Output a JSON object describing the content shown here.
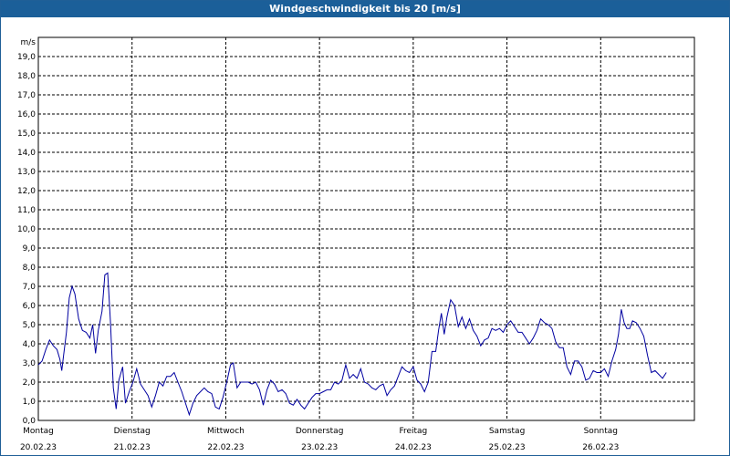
{
  "title": "Windgeschwindigkeit bis 20 [m/s]",
  "colors": {
    "title_bg": "#1b5f99",
    "title_text": "#ffffff",
    "series": "#0000a0",
    "grid": "#000000"
  },
  "chart_data": {
    "type": "line",
    "title": "Windgeschwindigkeit bis 20 [m/s]",
    "ylabel": "m/s",
    "ylim": [
      0,
      20
    ],
    "yticks": [
      "0,0",
      "1,0",
      "2,0",
      "3,0",
      "4,0",
      "5,0",
      "6,0",
      "7,0",
      "8,0",
      "9,0",
      "10,0",
      "11,0",
      "12,0",
      "13,0",
      "14,0",
      "15,0",
      "16,0",
      "17,0",
      "18,0",
      "19,0"
    ],
    "xlim": [
      0,
      7
    ],
    "x_unit": "days from 20.02.23 00:00",
    "day_ticks": [
      {
        "day": "Montag",
        "date": "20.02.23"
      },
      {
        "day": "Dienstag",
        "date": "21.02.23"
      },
      {
        "day": "Mittwoch",
        "date": "22.02.23"
      },
      {
        "day": "Donnerstag",
        "date": "23.02.23"
      },
      {
        "day": "Freitag",
        "date": "24.02.23"
      },
      {
        "day": "Samstag",
        "date": "25.02.23"
      },
      {
        "day": "Sonntag",
        "date": "26.02.23"
      }
    ],
    "grid": true,
    "series": [
      {
        "color": "#0000a0",
        "points": [
          [
            0.0,
            2.9
          ],
          [
            0.04,
            3.1
          ],
          [
            0.08,
            3.7
          ],
          [
            0.12,
            4.2
          ],
          [
            0.16,
            3.9
          ],
          [
            0.2,
            3.7
          ],
          [
            0.23,
            3.2
          ],
          [
            0.25,
            2.6
          ],
          [
            0.27,
            3.4
          ],
          [
            0.3,
            4.6
          ],
          [
            0.33,
            6.4
          ],
          [
            0.36,
            7.0
          ],
          [
            0.39,
            6.6
          ],
          [
            0.43,
            5.3
          ],
          [
            0.47,
            4.7
          ],
          [
            0.51,
            4.6
          ],
          [
            0.55,
            4.3
          ],
          [
            0.58,
            5.0
          ],
          [
            0.61,
            3.5
          ],
          [
            0.64,
            4.7
          ],
          [
            0.68,
            5.7
          ],
          [
            0.71,
            7.6
          ],
          [
            0.74,
            7.7
          ],
          [
            0.77,
            5.1
          ],
          [
            0.8,
            1.7
          ],
          [
            0.83,
            0.6
          ],
          [
            0.86,
            2.1
          ],
          [
            0.9,
            2.8
          ],
          [
            0.93,
            0.9
          ],
          [
            0.97,
            1.5
          ],
          [
            1.01,
            2.0
          ],
          [
            1.05,
            2.7
          ],
          [
            1.09,
            1.9
          ],
          [
            1.13,
            1.6
          ],
          [
            1.17,
            1.3
          ],
          [
            1.21,
            0.7
          ],
          [
            1.25,
            1.3
          ],
          [
            1.29,
            2.0
          ],
          [
            1.33,
            1.8
          ],
          [
            1.37,
            2.3
          ],
          [
            1.41,
            2.3
          ],
          [
            1.45,
            2.5
          ],
          [
            1.49,
            2.0
          ],
          [
            1.53,
            1.5
          ],
          [
            1.57,
            0.9
          ],
          [
            1.61,
            0.3
          ],
          [
            1.65,
            0.9
          ],
          [
            1.69,
            1.3
          ],
          [
            1.73,
            1.5
          ],
          [
            1.77,
            1.7
          ],
          [
            1.81,
            1.5
          ],
          [
            1.85,
            1.4
          ],
          [
            1.89,
            0.7
          ],
          [
            1.93,
            0.6
          ],
          [
            1.97,
            1.2
          ],
          [
            2.01,
            2.0
          ],
          [
            2.05,
            2.9
          ],
          [
            2.08,
            3.0
          ],
          [
            2.12,
            1.7
          ],
          [
            2.16,
            2.0
          ],
          [
            2.2,
            2.0
          ],
          [
            2.24,
            2.0
          ],
          [
            2.28,
            1.9
          ],
          [
            2.32,
            2.0
          ],
          [
            2.36,
            1.6
          ],
          [
            2.4,
            0.8
          ],
          [
            2.44,
            1.6
          ],
          [
            2.48,
            2.1
          ],
          [
            2.52,
            1.9
          ],
          [
            2.56,
            1.5
          ],
          [
            2.6,
            1.6
          ],
          [
            2.64,
            1.4
          ],
          [
            2.68,
            0.9
          ],
          [
            2.72,
            0.8
          ],
          [
            2.76,
            1.1
          ],
          [
            2.8,
            0.8
          ],
          [
            2.84,
            0.6
          ],
          [
            2.88,
            0.9
          ],
          [
            2.92,
            1.2
          ],
          [
            2.96,
            1.4
          ],
          [
            3.0,
            1.4
          ],
          [
            3.04,
            1.5
          ],
          [
            3.08,
            1.6
          ],
          [
            3.12,
            1.6
          ],
          [
            3.16,
            2.0
          ],
          [
            3.2,
            1.9
          ],
          [
            3.24,
            2.1
          ],
          [
            3.28,
            2.9
          ],
          [
            3.32,
            2.2
          ],
          [
            3.36,
            2.4
          ],
          [
            3.4,
            2.2
          ],
          [
            3.44,
            2.7
          ],
          [
            3.48,
            2.0
          ],
          [
            3.52,
            1.9
          ],
          [
            3.56,
            1.7
          ],
          [
            3.6,
            1.6
          ],
          [
            3.64,
            1.8
          ],
          [
            3.68,
            1.9
          ],
          [
            3.72,
            1.3
          ],
          [
            3.76,
            1.6
          ],
          [
            3.8,
            1.8
          ],
          [
            3.84,
            2.3
          ],
          [
            3.88,
            2.8
          ],
          [
            3.92,
            2.6
          ],
          [
            3.96,
            2.5
          ],
          [
            4.0,
            2.8
          ],
          [
            4.04,
            2.1
          ],
          [
            4.08,
            1.9
          ],
          [
            4.12,
            1.5
          ],
          [
            4.16,
            2.0
          ],
          [
            4.2,
            3.6
          ],
          [
            4.24,
            3.6
          ],
          [
            4.27,
            4.7
          ],
          [
            4.3,
            5.6
          ],
          [
            4.33,
            4.5
          ],
          [
            4.36,
            5.4
          ],
          [
            4.4,
            6.3
          ],
          [
            4.44,
            6.0
          ],
          [
            4.48,
            4.9
          ],
          [
            4.52,
            5.4
          ],
          [
            4.56,
            4.8
          ],
          [
            4.6,
            5.3
          ],
          [
            4.64,
            4.7
          ],
          [
            4.68,
            4.4
          ],
          [
            4.72,
            3.9
          ],
          [
            4.76,
            4.2
          ],
          [
            4.8,
            4.3
          ],
          [
            4.84,
            4.8
          ],
          [
            4.88,
            4.7
          ],
          [
            4.92,
            4.8
          ],
          [
            4.96,
            4.6
          ],
          [
            5.0,
            5.0
          ],
          [
            5.04,
            5.2
          ],
          [
            5.08,
            4.9
          ],
          [
            5.12,
            4.6
          ],
          [
            5.16,
            4.6
          ],
          [
            5.2,
            4.3
          ],
          [
            5.24,
            4.0
          ],
          [
            5.28,
            4.3
          ],
          [
            5.32,
            4.7
          ],
          [
            5.36,
            5.3
          ],
          [
            5.4,
            5.1
          ],
          [
            5.44,
            5.0
          ],
          [
            5.48,
            4.8
          ],
          [
            5.52,
            4.1
          ],
          [
            5.56,
            3.8
          ],
          [
            5.6,
            3.8
          ],
          [
            5.64,
            2.8
          ],
          [
            5.68,
            2.4
          ],
          [
            5.72,
            3.1
          ],
          [
            5.76,
            3.1
          ],
          [
            5.8,
            2.8
          ],
          [
            5.84,
            2.1
          ],
          [
            5.88,
            2.2
          ],
          [
            5.92,
            2.6
          ],
          [
            5.96,
            2.5
          ],
          [
            6.0,
            2.5
          ],
          [
            6.04,
            2.7
          ],
          [
            6.08,
            2.3
          ],
          [
            6.12,
            3.1
          ],
          [
            6.16,
            3.7
          ],
          [
            6.19,
            4.5
          ],
          [
            6.22,
            5.8
          ],
          [
            6.25,
            5.1
          ],
          [
            6.28,
            4.8
          ],
          [
            6.31,
            4.8
          ],
          [
            6.34,
            5.2
          ],
          [
            6.38,
            5.1
          ],
          [
            6.42,
            4.8
          ],
          [
            6.46,
            4.4
          ],
          [
            6.5,
            3.4
          ],
          [
            6.54,
            2.5
          ],
          [
            6.58,
            2.6
          ],
          [
            6.62,
            2.4
          ],
          [
            6.66,
            2.2
          ],
          [
            6.7,
            2.5
          ]
        ]
      }
    ]
  }
}
